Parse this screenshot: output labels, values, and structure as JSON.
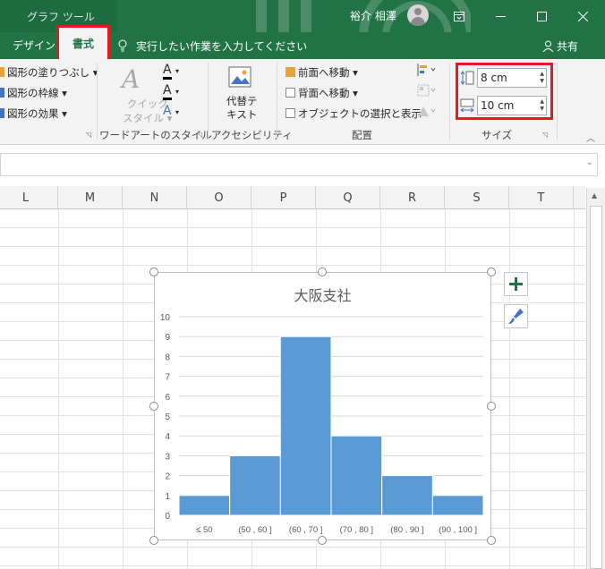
{
  "titlebar": {
    "tool_tab": "グラフ ツール",
    "user_name": "裕介 相澤",
    "ribbon_display_icon": "ribbon-display-icon",
    "minimize_icon": "minimize-icon",
    "maximize_icon": "maximize-icon",
    "close_icon": "close-icon"
  },
  "tabs": {
    "design": "デザイン",
    "format": "書式",
    "tell_me": "実行したい作業を入力してください",
    "share": "共有"
  },
  "ribbon": {
    "shape_fill": "図形の塗りつぶし",
    "shape_outline": "図形の枠線",
    "shape_effects": "図形の効果",
    "quick_styles_line1": "クイック",
    "quick_styles_line2": "スタイル",
    "wordart_group": "ワードアートのスタイル",
    "alt_text_line1": "代替テ",
    "alt_text_line2": "キスト",
    "accessibility_group": "アクセシビリティ",
    "bring_forward": "前面へ移動",
    "send_backward": "背面へ移動",
    "selection_pane": "オブジェクトの選択と表示",
    "arrange_group": "配置",
    "height_value": "8 cm",
    "width_value": "10 cm",
    "size_group": "サイズ",
    "accent_color": "#217346",
    "highlight_color": "#e8191e"
  },
  "columns": [
    "L",
    "M",
    "N",
    "O",
    "P",
    "Q",
    "R",
    "S",
    "T"
  ],
  "chart_data": {
    "type": "bar",
    "title": "大阪支社",
    "categories": [
      "≤ 50",
      "(50 , 60 ]",
      "(60 , 70 ]",
      "(70 , 80 ]",
      "(80 , 90 ]",
      "(90 , 100 ]"
    ],
    "values": [
      1,
      3,
      9,
      4,
      2,
      1
    ],
    "ylim": [
      0,
      10
    ],
    "yticks": [
      "0",
      "1",
      "2",
      "3",
      "4",
      "5",
      "6",
      "7",
      "8",
      "9",
      "10"
    ],
    "bar_color": "#5b9bd5",
    "grid": true,
    "gap": "none (histogram)"
  }
}
